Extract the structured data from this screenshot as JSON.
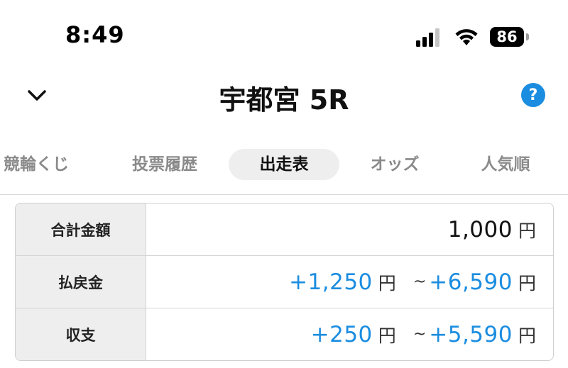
{
  "status_bar": {
    "time": "8:49",
    "battery_level": "86",
    "signal_icon": "cellular-signal-icon",
    "wifi_icon": "wifi-icon"
  },
  "header": {
    "title": "宇都宮 5R",
    "back_icon": "chevron-down-icon",
    "help_label": "?"
  },
  "tabs": [
    {
      "label": "競輪くじ",
      "active": false
    },
    {
      "label": "投票履歴",
      "active": false
    },
    {
      "label": "出走表",
      "active": true
    },
    {
      "label": "オッズ",
      "active": false
    },
    {
      "label": "人気順",
      "active": false
    }
  ],
  "summary": {
    "total": {
      "label": "合計金額",
      "amount": "1,000",
      "unit": "円"
    },
    "payout": {
      "label": "払戻金",
      "min": "+1,250",
      "min_unit": "円",
      "separator": "~",
      "max": "+6,590",
      "max_unit": "円"
    },
    "balance": {
      "label": "収支",
      "min": "+250",
      "min_unit": "円",
      "separator": "~",
      "max": "+5,590",
      "max_unit": "円"
    }
  },
  "colors": {
    "accent": "#1b8de0",
    "active_tab_bg": "#eeeeee",
    "label_cell_bg": "#eeeeee"
  }
}
